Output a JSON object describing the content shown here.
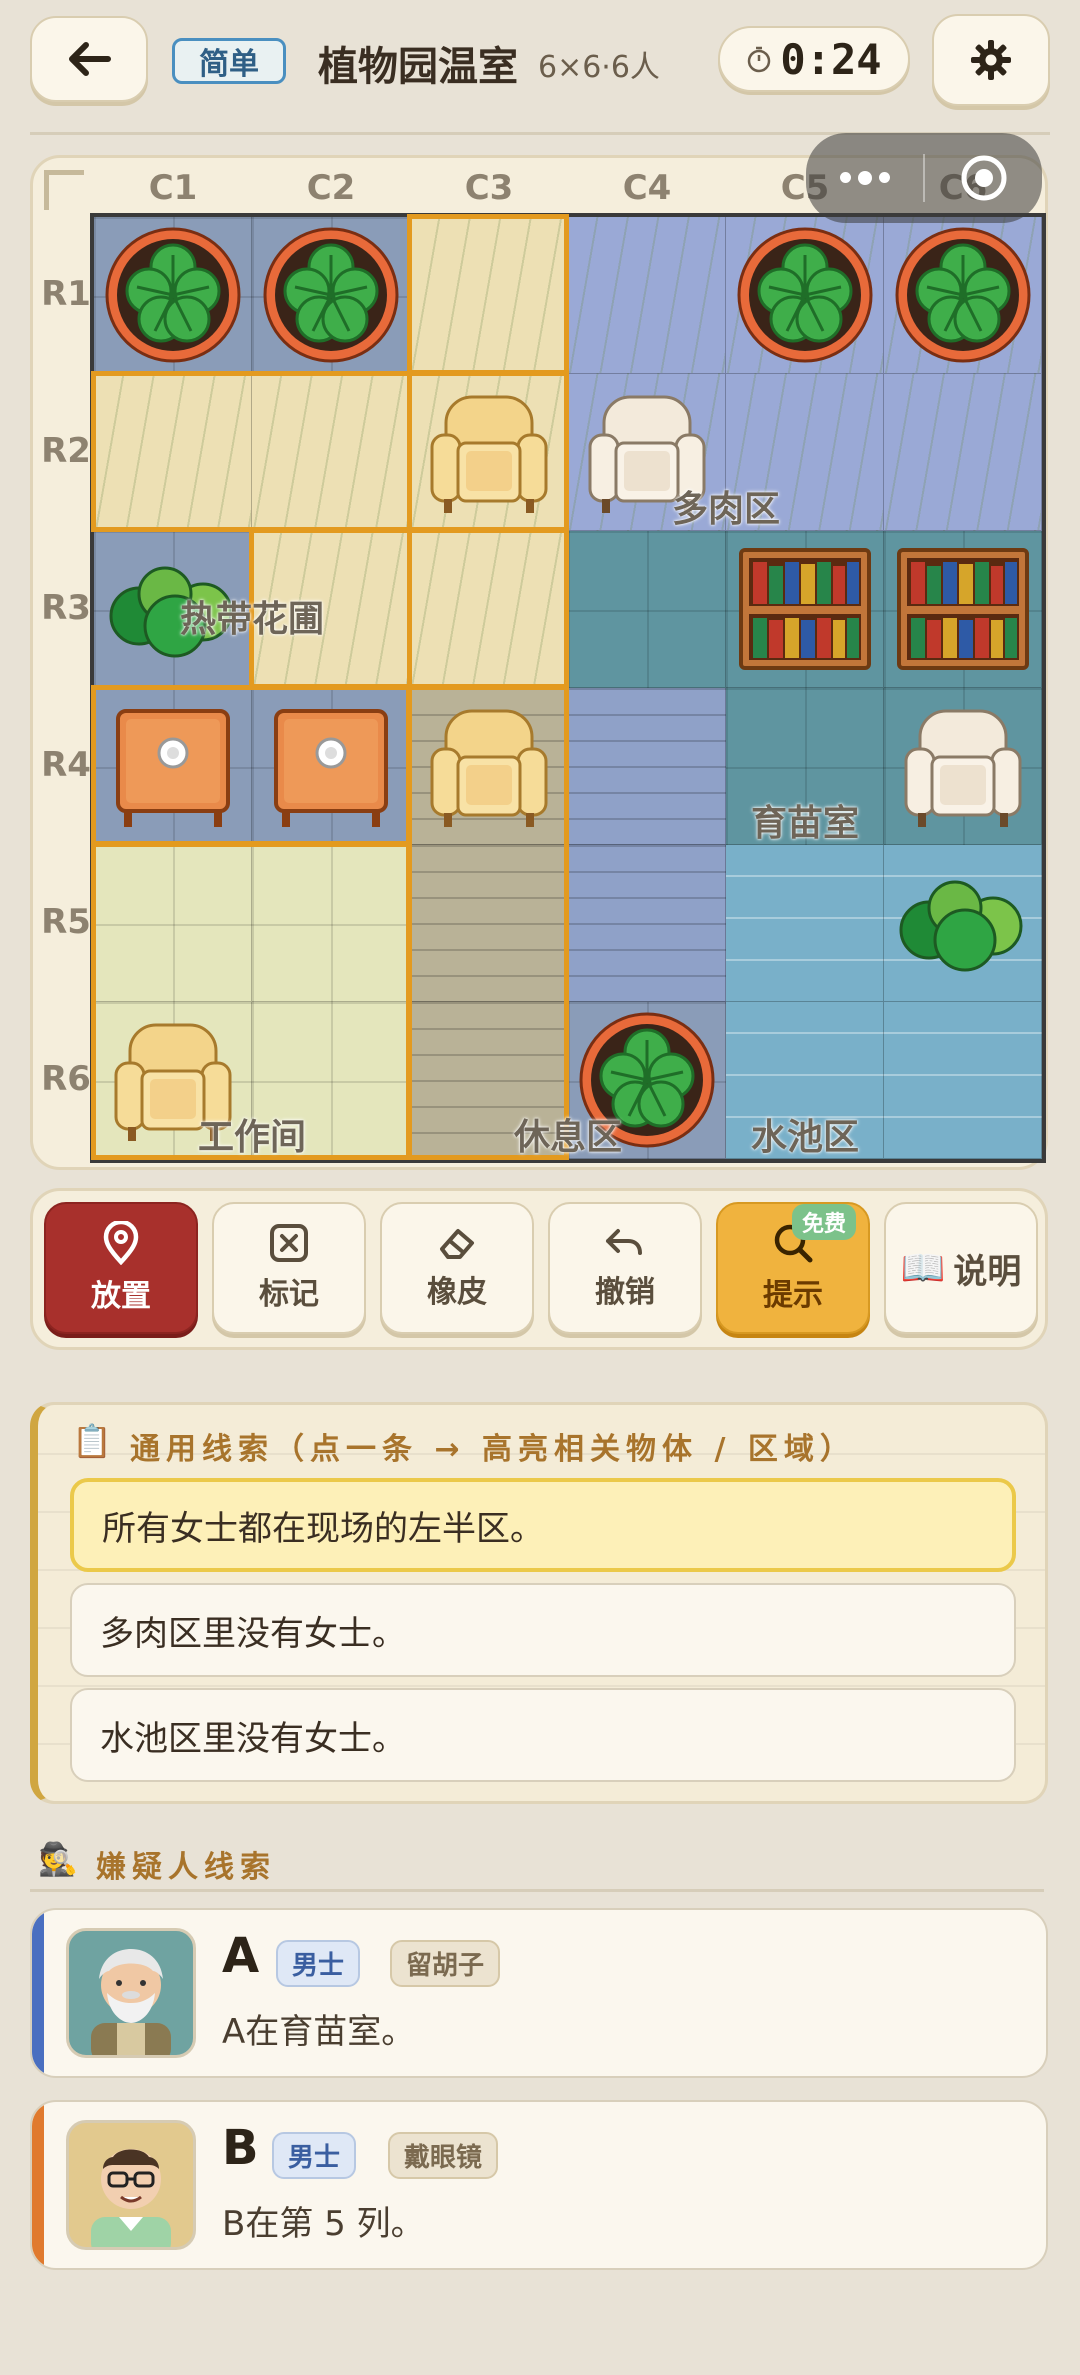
{
  "header": {
    "difficulty": "简单",
    "title": "植物园温室",
    "subtitle": "6×6·6人",
    "timer": "0:24"
  },
  "board": {
    "columns": [
      "C1",
      "C2",
      "C3",
      "C4",
      "C5",
      "C6"
    ],
    "rows": [
      "R1",
      "R2",
      "R3",
      "R4",
      "R5",
      "R6"
    ],
    "zones": {
      "tropical": "热带花圃",
      "succulent": "多肉区",
      "nursery": "育苗室",
      "workshop": "工作间",
      "rest": "休息区",
      "pool": "水池区"
    },
    "cells": [
      [
        "grayblue",
        "grayblue",
        "tropical",
        "succulent",
        "succulent",
        "succulent"
      ],
      [
        "tropical",
        "tropical",
        "tropical",
        "succulent",
        "succulent",
        "succulent"
      ],
      [
        "grayblue",
        "tropical",
        "tropical",
        "nursery",
        "nursery",
        "nursery"
      ],
      [
        "grayblue",
        "grayblue",
        "rest",
        "planks",
        "nursery",
        "nursery"
      ],
      [
        "workshop",
        "workshop",
        "rest",
        "planks",
        "pool",
        "pool"
      ],
      [
        "workshop",
        "workshop",
        "rest",
        "grayblue",
        "pool",
        "pool"
      ]
    ],
    "objects": [
      [
        "plant",
        "plant",
        "",
        "",
        "plant",
        "plant"
      ],
      [
        "",
        "",
        "armchair",
        "armchair-white",
        "",
        ""
      ],
      [
        "bush",
        "",
        "",
        "",
        "bookshelf",
        "bookshelf"
      ],
      [
        "table",
        "table",
        "armchair",
        "",
        "",
        "armchair-white"
      ],
      [
        "",
        "",
        "",
        "",
        "",
        "bush"
      ],
      [
        "armchair",
        "",
        "",
        "plant",
        "",
        ""
      ]
    ]
  },
  "toolbar": {
    "place": "放置",
    "mark": "标记",
    "eraser": "橡皮",
    "undo": "撤销",
    "hint": "提示",
    "free": "免费",
    "help": "说明"
  },
  "clues": {
    "heading": "通用线索（点一条 → 高亮相关物体 / 区域）",
    "items": [
      "所有女士都在现场的左半区。",
      "多肉区里没有女士。",
      "水池区里没有女士。"
    ]
  },
  "suspects": {
    "heading": "嫌疑人线索",
    "list": [
      {
        "name": "A",
        "gender": "男士",
        "feature": "留胡子",
        "clue": "A在育苗室。",
        "color": "#4a6fc0"
      },
      {
        "name": "B",
        "gender": "男士",
        "feature": "戴眼镜",
        "clue": "B在第 5 列。",
        "color": "#e07a2e"
      }
    ]
  }
}
